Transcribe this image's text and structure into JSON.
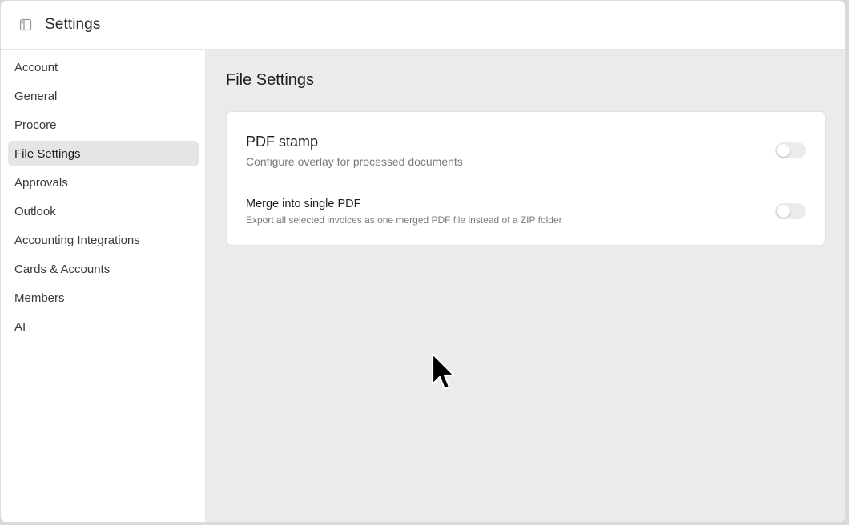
{
  "header": {
    "title": "Settings",
    "toggle_icon": "sidebar-toggle-icon"
  },
  "sidebar": {
    "items": [
      {
        "label": "Account",
        "active": false
      },
      {
        "label": "General",
        "active": false
      },
      {
        "label": "Procore",
        "active": false
      },
      {
        "label": "File Settings",
        "active": true
      },
      {
        "label": "Approvals",
        "active": false
      },
      {
        "label": "Outlook",
        "active": false
      },
      {
        "label": "Accounting Integrations",
        "active": false
      },
      {
        "label": "Cards & Accounts",
        "active": false
      },
      {
        "label": "Members",
        "active": false
      },
      {
        "label": "AI",
        "active": false
      }
    ]
  },
  "main": {
    "title": "File Settings",
    "settings": [
      {
        "title": "PDF stamp",
        "description": "Configure overlay for processed documents",
        "enabled": false
      },
      {
        "title": "Merge into single PDF",
        "description": "Export all selected invoices as one merged PDF file instead of a ZIP folder",
        "enabled": false
      }
    ]
  },
  "colors": {
    "main_bg": "#ebebeb",
    "active_nav_bg": "#e5e5e5",
    "toggle_off": "#ececec"
  }
}
